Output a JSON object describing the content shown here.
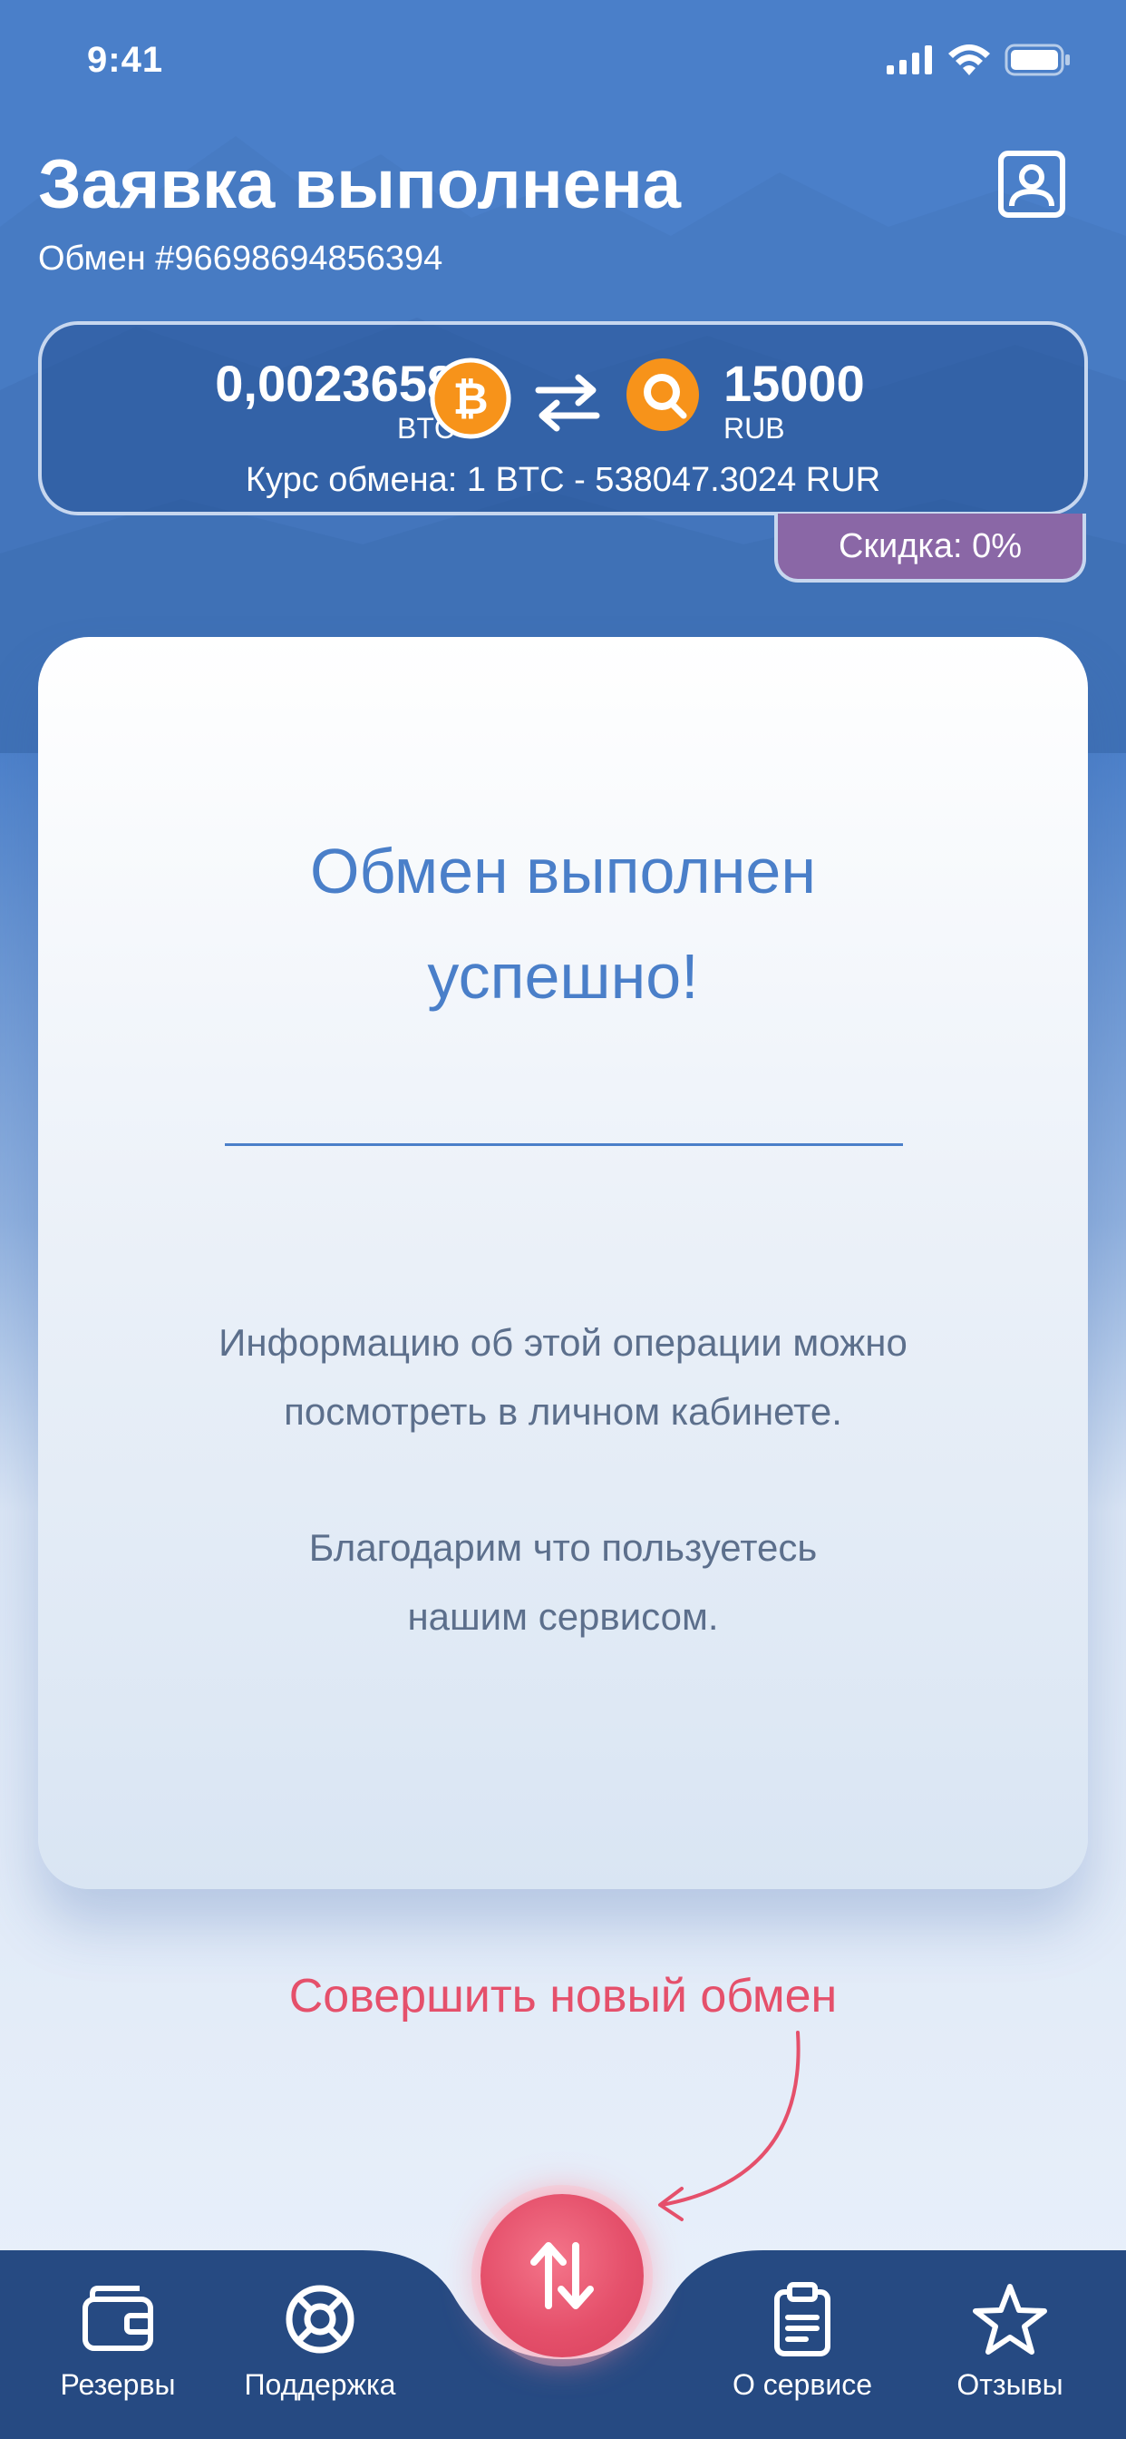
{
  "status_bar": {
    "time": "9:41"
  },
  "header": {
    "title": "Заявка выполнена",
    "order_number": "Обмен #96698694856394"
  },
  "exchange": {
    "from_amount": "0,0023658",
    "from_currency": "BTC",
    "to_amount": "15000",
    "to_currency": "RUB",
    "rate": "Курс обмена: 1 BTC - 538047.3024 RUR",
    "discount": "Скидка: 0%",
    "icons": [
      "bitcoin-icon",
      "swap-icon",
      "qiwi-icon"
    ]
  },
  "result": {
    "title_line1": "Обмен выполнен",
    "title_line2": "успешно!",
    "info_line1": "Информацию об этой операции можно",
    "info_line2": "посмотреть в личном кабинете.",
    "thanks_line1": "Благодарим что пользуетесь",
    "thanks_line2": "нашим сервисом."
  },
  "new_exchange_label": "Совершить новый обмен",
  "tabbar": {
    "items": [
      {
        "label": "Резервы",
        "icon": "wallet-icon"
      },
      {
        "label": "Поддержка",
        "icon": "lifebuoy-icon"
      },
      {
        "label": "О сервисе",
        "icon": "clipboard-icon"
      },
      {
        "label": "Отзывы",
        "icon": "star-icon"
      }
    ],
    "center_icon": "exchange-arrows-icon"
  },
  "colors": {
    "primary": "#4a7fc9",
    "accent": "#e5506b",
    "tabbar": "#264a82",
    "discount": "#8a67a6"
  }
}
